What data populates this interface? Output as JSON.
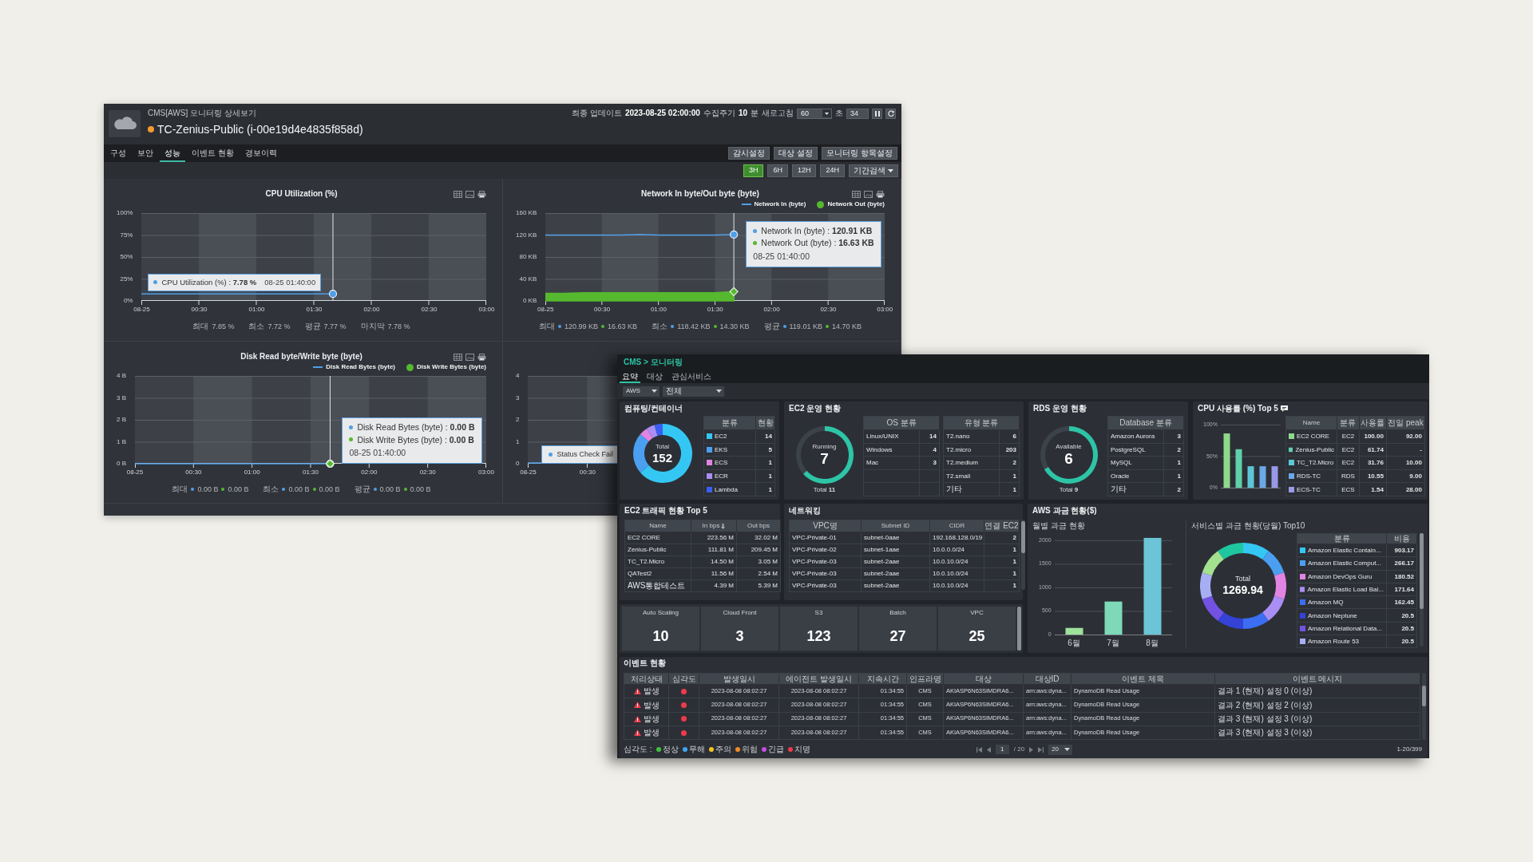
{
  "detail_window": {
    "breadcrumb": "CMS[AWS] 모니터링 상세보기",
    "title": "TC-Zenius-Public (i-00e19d4e4835f858d)",
    "warning": true,
    "update": {
      "last_update_label": "최종 업데이트",
      "last_update": "2023-08-25 02:00:00",
      "interval_label": "수집주기",
      "interval": "10",
      "interval_unit": "분",
      "refresh_label": "새로고침",
      "refresh_seconds": "60",
      "refresh_unit": "초",
      "countdown": "34"
    },
    "tabs": [
      {
        "label": "구성",
        "selected": false
      },
      {
        "label": "보안",
        "selected": false
      },
      {
        "label": "성능",
        "selected": true
      },
      {
        "label": "이벤트 현황",
        "selected": false
      },
      {
        "label": "경보이력",
        "selected": false
      }
    ],
    "actions": [
      "감시설정",
      "대상 설정",
      "모니터링 항목설정"
    ],
    "ranges": [
      {
        "label": "3H",
        "selected": true
      },
      {
        "label": "6H",
        "selected": false
      },
      {
        "label": "12H",
        "selected": false
      },
      {
        "label": "24H",
        "selected": false
      }
    ],
    "period_search": "기간검색",
    "charts": [
      {
        "kind": "full",
        "title": "CPU Utilization (%)",
        "chart_data": {
          "type": "line",
          "x": [
            0,
            10,
            20,
            30,
            40,
            50,
            60,
            70,
            80,
            90,
            100
          ],
          "xlim": [
            0,
            180
          ],
          "xticks": [
            {
              "value": 0,
              "label": "08-25"
            },
            {
              "value": 30,
              "label": "00:30"
            },
            {
              "value": 60,
              "label": "01:00"
            },
            {
              "value": 90,
              "label": "01:30"
            },
            {
              "value": 120,
              "label": "02:00"
            },
            {
              "value": 150,
              "label": "02:30"
            },
            {
              "value": 180,
              "label": "03:00"
            }
          ],
          "ylim": [
            0,
            100
          ],
          "yticks": [
            {
              "value": 0,
              "label": "0%"
            },
            {
              "value": 25,
              "label": "25%"
            },
            {
              "value": 50,
              "label": "50%"
            },
            {
              "value": 75,
              "label": "75%"
            },
            {
              "value": 100,
              "label": "100%"
            }
          ],
          "grid": true,
          "ref_lines": [
            {
              "axis": "x",
              "value": 100
            }
          ],
          "series": [
            {
              "type": "line",
              "color": "#4f9fe8",
              "values": [
                8,
                8,
                8,
                8,
                8,
                8,
                8,
                8,
                8,
                8,
                8
              ]
            }
          ]
        },
        "tooltip": {
          "kind": "inline",
          "lines": [
            "CPU Utilization (%) : **7.78 %**"
          ],
          "time": "08-25 01:40:00"
        },
        "stats": [
          {
            "label": "최대",
            "values": [
              "7.85 %"
            ]
          },
          {
            "label": "최소",
            "values": [
              "7.72 %"
            ]
          },
          {
            "label": "평균",
            "values": [
              "7.77 %"
            ]
          },
          {
            "label": "마지막",
            "values": [
              "7.78 %"
            ]
          }
        ]
      },
      {
        "kind": "full",
        "title": "Network In byte/Out byte (byte)",
        "chart_data": {
          "type": "line",
          "x": [
            0,
            10,
            20,
            30,
            40,
            50,
            60,
            70,
            80,
            90,
            100
          ],
          "xlim": [
            0,
            180
          ],
          "xticks": [
            {
              "value": 0,
              "label": "08-25"
            },
            {
              "value": 30,
              "label": "00:30"
            },
            {
              "value": 60,
              "label": "01:00"
            },
            {
              "value": 90,
              "label": "01:30"
            },
            {
              "value": 120,
              "label": "02:00"
            },
            {
              "value": 150,
              "label": "02:30"
            },
            {
              "value": 180,
              "label": "03:00"
            }
          ],
          "ylim": [
            0,
            160
          ],
          "yticks": [
            {
              "value": 0,
              "label": "0 KB"
            },
            {
              "value": 40,
              "label": "40 KB"
            },
            {
              "value": 80,
              "label": "80 KB"
            },
            {
              "value": 120,
              "label": "120 KB"
            },
            {
              "value": 160,
              "label": "160 KB"
            }
          ],
          "grid": true,
          "ref_lines": [
            {
              "axis": "x",
              "value": 100
            }
          ],
          "series": [
            {
              "name": "Network In (byte)",
              "type": "line",
              "color": "#4f9fe8",
              "values": [
                120,
                120,
                120,
                120,
                120,
                121,
                120,
                120,
                120,
                120,
                121
              ]
            },
            {
              "name": "Network Out (byte)",
              "type": "area",
              "color": "#56b82f",
              "values": [
                14,
                14,
                15,
                15,
                15,
                15,
                15,
                15,
                15,
                15,
                17
              ]
            }
          ]
        },
        "tooltip": {
          "kind": "stacked",
          "lines": [
            "Network In (byte) : **120.91 KB**",
            "Network Out (byte) : **16.63 KB**"
          ],
          "time": "08-25 01:40:00"
        },
        "stats": [
          {
            "label": "최대",
            "values": [
              "120.99 KB",
              "16.63 KB"
            ]
          },
          {
            "label": "최소",
            "values": [
              "118.42 KB",
              "14.30 KB"
            ]
          },
          {
            "label": "평균",
            "values": [
              "119.01 KB",
              "14.70 KB"
            ]
          }
        ]
      },
      {
        "kind": "full",
        "title": "Disk Read byte/Write byte (byte)",
        "chart_data": {
          "type": "line",
          "x": [
            0,
            10,
            20,
            30,
            40,
            50,
            60,
            70,
            80,
            90,
            100
          ],
          "xlim": [
            0,
            180
          ],
          "xticks": [
            {
              "value": 0,
              "label": "08-25"
            },
            {
              "value": 30,
              "label": "00:30"
            },
            {
              "value": 60,
              "label": "01:00"
            },
            {
              "value": 90,
              "label": "01:30"
            },
            {
              "value": 120,
              "label": "02:00"
            },
            {
              "value": 150,
              "label": "02:30"
            },
            {
              "value": 180,
              "label": "03:00"
            }
          ],
          "ylim": [
            0,
            4
          ],
          "yticks": [
            {
              "value": 0,
              "label": "0 B"
            },
            {
              "value": 1,
              "label": "1 B"
            },
            {
              "value": 2,
              "label": "2 B"
            },
            {
              "value": 3,
              "label": "3 B"
            },
            {
              "value": 4,
              "label": "4 B"
            }
          ],
          "grid": true,
          "ref_lines": [
            {
              "axis": "x",
              "value": 100
            }
          ],
          "series": [
            {
              "name": "Disk Read Bytes (byte)",
              "type": "line",
              "color": "#4f9fe8",
              "values": [
                0,
                0,
                0,
                0,
                0,
                0,
                0,
                0,
                0,
                0,
                0
              ]
            },
            {
              "name": "Disk Write Bytes (byte)",
              "type": "scatter",
              "color": "#56b82f",
              "values": [
                null,
                null,
                null,
                null,
                null,
                null,
                null,
                null,
                null,
                null,
                0
              ]
            }
          ]
        },
        "tooltip": {
          "kind": "stacked",
          "lines": [
            "Disk Read Bytes (byte) : **0.00 B**",
            "Disk Write Bytes (byte) : **0.00 B**"
          ],
          "time": "08-25 01:40:00"
        },
        "stats": [
          {
            "label": "최대",
            "values": [
              "0.00 B",
              "0.00 B"
            ]
          },
          {
            "label": "최소",
            "values": [
              "0.00 B",
              "0.00 B"
            ]
          },
          {
            "label": "평균",
            "values": [
              "0.00 B",
              "0.00 B"
            ]
          }
        ]
      },
      {
        "kind": "covered",
        "y_labels": [
          "4",
          "3",
          "2",
          "1",
          "0"
        ],
        "x_labels": [
          "08-25",
          "00:30"
        ],
        "tooltip": {
          "kind": "inline",
          "lines": [
            "Status Check Fail"
          ]
        }
      }
    ]
  },
  "dashboard_window": {
    "breadcrumb": "CMS > 모니터링",
    "tabs": [
      {
        "label": "요약",
        "selected": true
      },
      {
        "label": "대상",
        "selected": false
      },
      {
        "label": "관심서비스",
        "selected": false
      }
    ],
    "filters": [
      "AWS",
      "전체"
    ],
    "compute": {
      "title": "컴퓨팅/컨테이너",
      "center_label": "Total",
      "center_value": "152",
      "chart_data": {
        "type": "donut",
        "values": [
          63.6,
          22.7,
          4.6,
          4.6,
          4.5
        ]
      },
      "table": {
        "columns": [
          "분류",
          "현황"
        ],
        "rows": [
          {
            "name": "EC2",
            "count": "14",
            "color": "#35c7f4"
          },
          {
            "name": "EKS",
            "count": "5",
            "color": "#4b9ff1"
          },
          {
            "name": "ECS",
            "count": "1",
            "color": "#e184e3"
          },
          {
            "name": "ECR",
            "count": "1",
            "color": "#a98ef3"
          },
          {
            "name": "Lambda",
            "count": "1",
            "color": "#3b5ef2"
          }
        ]
      }
    },
    "ec2": {
      "title": "EC2 운영 현황",
      "gauge": {
        "label": "Running",
        "value": "7",
        "total": "Total **11**",
        "chart_data": {
          "type": "donut",
          "values": [
            63.6,
            36.4
          ]
        }
      },
      "tables": [
        {
          "header": "OS 분류",
          "rows": [
            {
              "name": "Linux/UNIX",
              "count": "14"
            },
            {
              "name": "Windows",
              "count": "4"
            },
            {
              "name": "Mac",
              "count": "3"
            }
          ]
        },
        {
          "header": "유형 분류",
          "rows": [
            {
              "name": "T2.nano",
              "count": "6"
            },
            {
              "name": "T2.micro",
              "count": "203"
            },
            {
              "name": "T2.medium",
              "count": "2"
            },
            {
              "name": "T2.small",
              "count": "1"
            },
            {
              "name": "기타",
              "count": "1"
            }
          ]
        }
      ]
    },
    "rds": {
      "title": "RDS 운영 현황",
      "gauge": {
        "label": "Available",
        "value": "6",
        "total": "Total **9**",
        "chart_data": {
          "type": "donut",
          "values": [
            66.7,
            33.3
          ]
        }
      },
      "tables": [
        {
          "header": "Database 분류",
          "rows": [
            {
              "name": "Amazon Aurora",
              "count": "3"
            },
            {
              "name": "PostgreSQL",
              "count": "2"
            },
            {
              "name": "MySQL",
              "count": "1"
            },
            {
              "name": "Oracle",
              "count": "1"
            },
            {
              "name": "기타",
              "count": "2"
            }
          ]
        }
      ]
    },
    "cpu_top5": {
      "title": "CPU 사용률 (%) Top 5",
      "chart_data": {
        "type": "bar",
        "values": [
          86,
          61,
          34,
          34,
          34
        ],
        "ylim": [
          0,
          100
        ],
        "yticks": [
          {
            "value": 0,
            "label": "0%"
          },
          {
            "value": 50,
            "label": "50%"
          },
          {
            "value": 100,
            "label": "100%"
          }
        ],
        "grid": true
      },
      "columns": [
        "Name",
        "분류",
        "사용률",
        "전일 peak"
      ],
      "rows": [
        {
          "name": "EC2 CORE",
          "type": "EC2",
          "usage": "100.00",
          "peak": "92.00",
          "color": "#8fd98a"
        },
        {
          "name": "Zenius-Public",
          "type": "EC2",
          "usage": "61.74",
          "peak": "-",
          "color": "#5fd0aa"
        },
        {
          "name": "TC_T2.Micro",
          "type": "EC2",
          "usage": "31.76",
          "peak": "10.00",
          "color": "#5cc6d8"
        },
        {
          "name": "RDS-TC",
          "type": "RDS",
          "usage": "10.55",
          "peak": "9.00",
          "color": "#6aa8e8"
        },
        {
          "name": "ECS-TC",
          "type": "ECS",
          "usage": "1.54",
          "peak": "28.00",
          "color": "#9a98e8"
        }
      ]
    },
    "traffic": {
      "title": "EC2 트래픽 현황 Top 5",
      "columns": [
        {
          "label": "Name",
          "sorted": false
        },
        {
          "label": "In bps",
          "sorted": true
        },
        {
          "label": "Out bps",
          "sorted": false
        }
      ],
      "rows": [
        [
          "EC2 CORE",
          "223.56 M",
          "32.02 M"
        ],
        [
          "Zenius-Public",
          "111.81 M",
          "209.45 M"
        ],
        [
          "TC_T2.Micro",
          "14.50 M",
          "3.05 M"
        ],
        [
          "QATest2",
          "11.56 M",
          "2.54 M"
        ],
        [
          "AWS통합테스트",
          "4.39 M",
          "5.39 M"
        ]
      ]
    },
    "networking": {
      "title": "네트워킹",
      "columns": [
        "VPC명",
        "Subnet ID",
        "CIDR",
        "연결 EC2"
      ],
      "rows": [
        [
          "VPC-Private-01",
          "subnet-0aae",
          "192.168.128.0/19",
          "2"
        ],
        [
          "VPC-Private-02",
          "subnet-1aae",
          "10.0.0.0/24",
          "1"
        ],
        [
          "VPC-Private-03",
          "subnet-2aae",
          "10.0.10.0/24",
          "1"
        ],
        [
          "VPC-Private-03",
          "subnet-2aae",
          "10.0.10.0/24",
          "1"
        ],
        [
          "VPC-Private-03",
          "subnet-2aae",
          "10.0.10.0/24",
          "1"
        ]
      ]
    },
    "tiles": [
      {
        "label": "Auto Scaling",
        "value": "10"
      },
      {
        "label": "Cloud Front",
        "value": "3"
      },
      {
        "label": "S3",
        "value": "123"
      },
      {
        "label": "Batch",
        "value": "27"
      },
      {
        "label": "VPC",
        "value": "25"
      }
    ],
    "billing": {
      "title": "AWS 과금 현황($)",
      "monthly": {
        "title": "월별 과금 현황",
        "chart_data": {
          "type": "bar",
          "categories": [
            "6월",
            "7월",
            "8월"
          ],
          "values": [
            140,
            700,
            2050
          ],
          "ylim": [
            0,
            2100
          ],
          "yticks": [
            0,
            500,
            1000,
            1500,
            2000
          ],
          "grid": true
        }
      },
      "services": {
        "title": "서비스별 과금 현황(당월) Top10",
        "center_label": "Total",
        "center_value": "1269.94",
        "columns": [
          "분류",
          "비용"
        ],
        "rows": [
          {
            "name": "Amazon Elastic Contain...",
            "cost": "903.17",
            "color": "#35c7f4"
          },
          {
            "name": "Amazon Elastic Comput...",
            "cost": "266.17",
            "color": "#4b9ff1"
          },
          {
            "name": "Amazon DevOps Guru",
            "cost": "180.52",
            "color": "#e184e3"
          },
          {
            "name": "Amazon Elastic Load Bal...",
            "cost": "171.64",
            "color": "#a98ef3"
          },
          {
            "name": "Amazon MQ",
            "cost": "162.45",
            "color": "#3b6ef2"
          },
          {
            "name": "Amazon Neptune",
            "cost": "20.5",
            "color": "#3442d6"
          },
          {
            "name": "Amazon Relational Data...",
            "cost": "20.5",
            "color": "#7352e3"
          },
          {
            "name": "Amazon Route 53",
            "cost": "20.5",
            "color": "#a6aff3"
          }
        ]
      }
    },
    "events": {
      "title": "이벤트 현황",
      "columns": [
        "처리상태",
        "심각도",
        "발생일시",
        "에이전트 발생일시",
        "지속시간",
        "인프라명",
        "대상",
        "대상ID",
        "이벤트 제목",
        "이벤트 메시지"
      ],
      "rows": [
        {
          "status": "발생",
          "color": "#ee3a4c",
          "occurred": "2023-08-08 08:02:27",
          "agent_time": "2023-08-08 08:02:27",
          "duration": "01:34:55",
          "infra": "CMS",
          "target": "AKIASP6N63SIMDRA6...",
          "target_id": "arn:aws:dyna...",
          "title": "DynamoDB Read Usage",
          "message": "결과 1 (현재) 설정 0 (이상)"
        },
        {
          "status": "발생",
          "color": "#ee3a4c",
          "occurred": "2023-08-08 08:02:27",
          "agent_time": "2023-08-08 08:02:27",
          "duration": "01:34:55",
          "infra": "CMS",
          "target": "AKIASP6N63SIMDRA6...",
          "target_id": "arn:aws:dyna...",
          "title": "DynamoDB Read Usage",
          "message": "결과 2 (현재) 설정 2 (이상)"
        },
        {
          "status": "발생",
          "color": "#ee3a4c",
          "occurred": "2023-08-08 08:02:27",
          "agent_time": "2023-08-08 08:02:27",
          "duration": "01:34:55",
          "infra": "CMS",
          "target": "AKIASP6N63SIMDRA6...",
          "target_id": "arn:aws:dyna...",
          "title": "DynamoDB Read Usage",
          "message": "결과 3 (현재) 설정 3 (이상)"
        },
        {
          "status": "발생",
          "color": "#ee3a4c",
          "occurred": "2023-08-08 08:02:27",
          "agent_time": "2023-08-08 08:02:27",
          "duration": "01:34:55",
          "infra": "CMS",
          "target": "AKIASP6N63SIMDRA6...",
          "target_id": "arn:aws:dyna...",
          "title": "DynamoDB Read Usage",
          "message": "결과 3 (현재) 설정 3 (이상)"
        }
      ],
      "severity_label": "심각도 :",
      "severities": [
        {
          "label": "정상",
          "color": "#3ec23e"
        },
        {
          "label": "무해",
          "color": "#3fa7f1"
        },
        {
          "label": "주의",
          "color": "#f3c320"
        },
        {
          "label": "위험",
          "color": "#f28b25"
        },
        {
          "label": "긴급",
          "color": "#c24ee2"
        },
        {
          "label": "치명",
          "color": "#ee3a4c"
        }
      ],
      "pagination": {
        "page": "1",
        "of": "/ 20",
        "page_size": "20",
        "range": "1-20/399"
      }
    }
  }
}
